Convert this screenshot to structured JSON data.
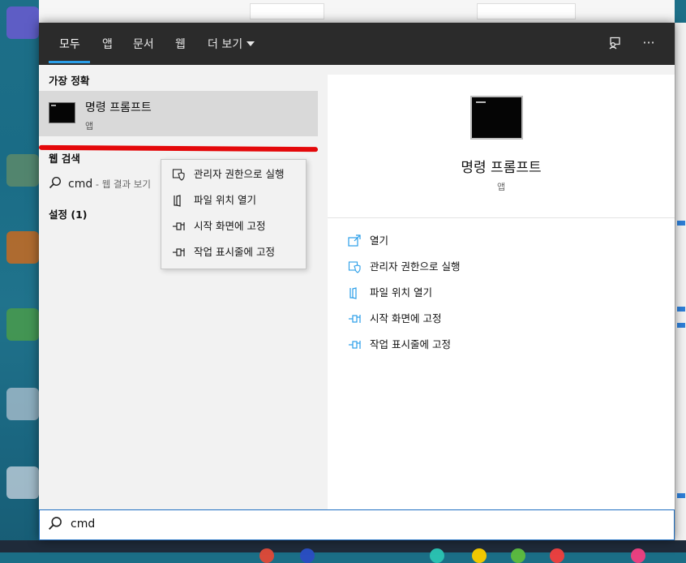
{
  "tabs": {
    "all": "모두",
    "apps": "앱",
    "documents": "문서",
    "web": "웹",
    "more": "더 보기"
  },
  "toolbar": {
    "feedback_icon": "feedback-icon",
    "more_options": "···"
  },
  "left": {
    "best_match_label": "가장 정확",
    "best_match": {
      "title": "명령 프롬프트",
      "subtitle": "앱"
    },
    "web_search_label": "웹 검색",
    "web_result": {
      "query": "cmd",
      "hint": " - 웹 결과 보기"
    },
    "settings_label": "설정 (1)"
  },
  "context_menu": {
    "items": [
      {
        "label": "관리자 권한으로 실행",
        "icon": "shield-icon"
      },
      {
        "label": "파일 위치 열기",
        "icon": "file-location-icon"
      },
      {
        "label": "시작 화면에 고정",
        "icon": "pin-icon"
      },
      {
        "label": "작업 표시줄에 고정",
        "icon": "pin-icon"
      }
    ]
  },
  "right": {
    "title": "명령 프롬프트",
    "subtitle": "앱",
    "actions": [
      {
        "label": "열기",
        "icon": "open-icon"
      },
      {
        "label": "관리자 권한으로 실행",
        "icon": "shield-icon"
      },
      {
        "label": "파일 위치 열기",
        "icon": "file-location-icon"
      },
      {
        "label": "시작 화면에 고정",
        "icon": "pin-icon"
      },
      {
        "label": "작업 표시줄에 고정",
        "icon": "pin-icon"
      }
    ]
  },
  "search": {
    "value": "cmd"
  },
  "colors": {
    "accent": "#2a9ee8",
    "annotation_red": "#e4080a",
    "panel_dark": "#2b2b2b"
  }
}
